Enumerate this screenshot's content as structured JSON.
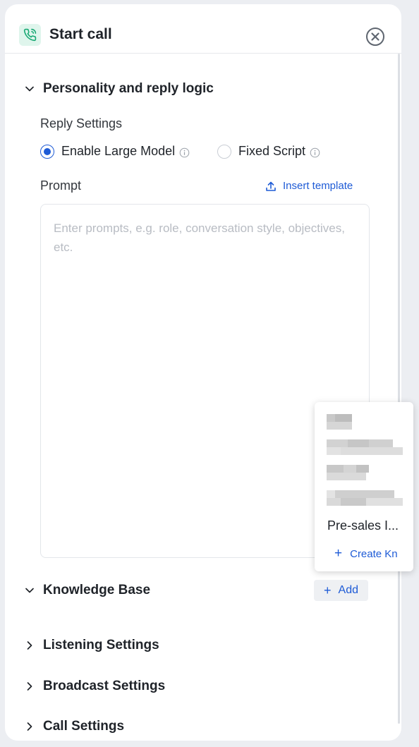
{
  "header": {
    "title": "Start call"
  },
  "sections": {
    "personality": {
      "label": "Personality and reply logic",
      "expanded": true
    },
    "knowledge": {
      "label": "Knowledge Base",
      "expanded": true,
      "add_label": "Add"
    },
    "listening": {
      "label": "Listening Settings",
      "expanded": false
    },
    "broadcast": {
      "label": "Broadcast Settings",
      "expanded": false
    },
    "call": {
      "label": "Call Settings",
      "expanded": false
    }
  },
  "reply_settings": {
    "title": "Reply Settings",
    "options": [
      {
        "label": "Enable Large Model",
        "selected": true
      },
      {
        "label": "Fixed Script",
        "selected": false
      }
    ]
  },
  "prompt": {
    "label": "Prompt",
    "insert_template": "Insert template",
    "placeholder": "Enter prompts, e.g. role, conversation style, objectives, etc.",
    "value": ""
  },
  "knowledge_dropdown": {
    "visible_item": "Pre-sales I...",
    "create_label": "Create Kn"
  },
  "colors": {
    "accent": "#1e5bd6",
    "icon_bg": "#dff5ec",
    "icon_fg": "#19a974"
  }
}
